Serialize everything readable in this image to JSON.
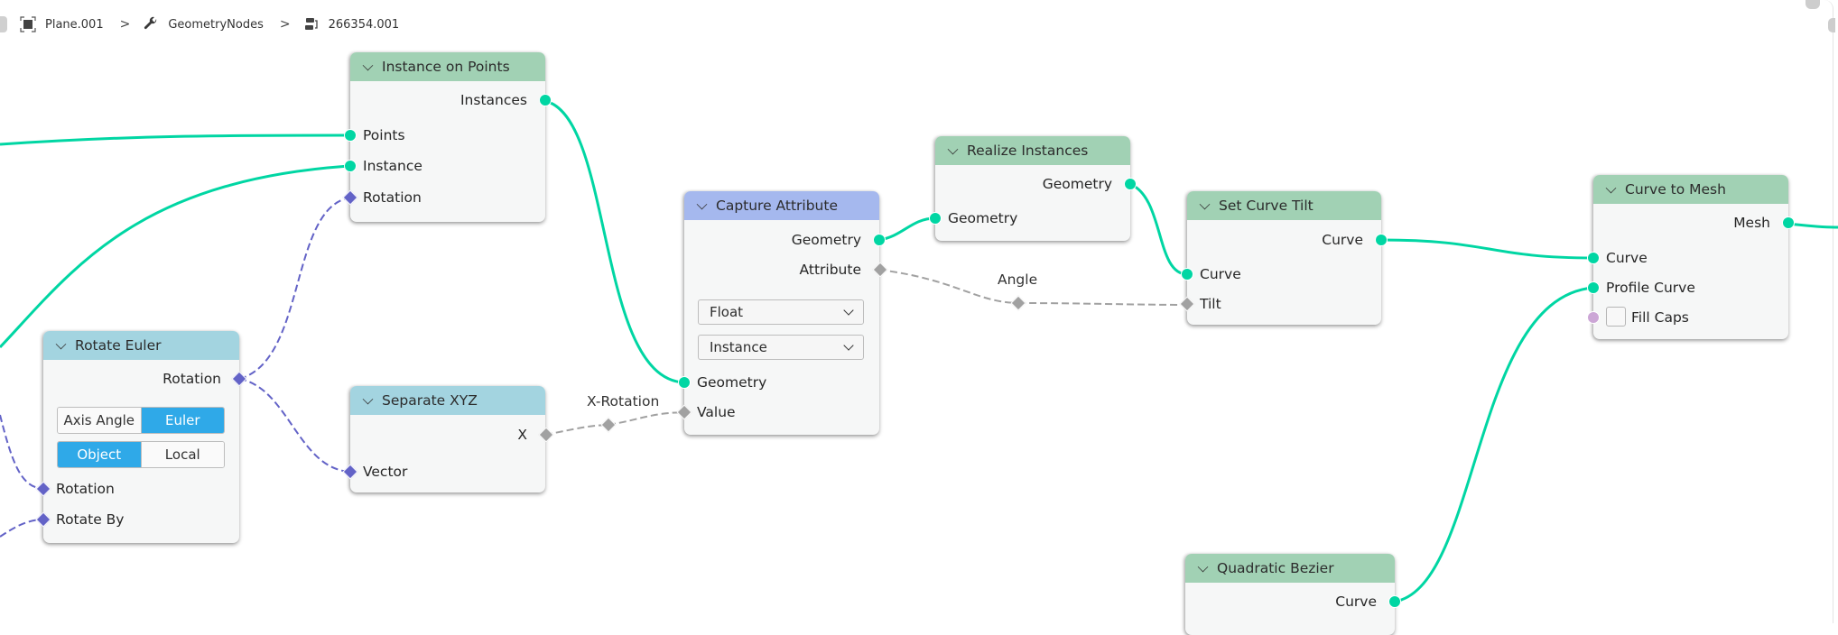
{
  "breadcrumb": {
    "items": [
      {
        "label": "Plane.001",
        "icon": "object-icon"
      },
      {
        "label": "GeometryNodes",
        "icon": "wrench-icon"
      },
      {
        "label": "266354.001",
        "icon": "node-tree-icon"
      }
    ],
    "separator": ">"
  },
  "colors": {
    "geometry_socket": "#00d6a3",
    "vector_socket": "#6363c7",
    "float_socket": "#a1a1a1",
    "boolean_socket": "#cca6d6",
    "geometry_header": "#a1d1b4",
    "vector_header": "#a3d4e0",
    "attribute_header": "#a5b8ee",
    "active_button": "#2fa9e8"
  },
  "nodes": {
    "instance_on_points": {
      "title": "Instance on Points",
      "outputs": [
        "Instances"
      ],
      "inputs": [
        "Points",
        "Instance",
        "Rotation"
      ]
    },
    "rotate_euler": {
      "title": "Rotate Euler",
      "outputs": [
        "Rotation"
      ],
      "type_options": [
        "Axis Angle",
        "Euler"
      ],
      "type_selected": "Euler",
      "space_options": [
        "Object",
        "Local"
      ],
      "space_selected": "Object",
      "inputs": [
        "Rotation",
        "Rotate By"
      ]
    },
    "separate_xyz": {
      "title": "Separate XYZ",
      "outputs": [
        "X"
      ],
      "inputs": [
        "Vector"
      ]
    },
    "capture_attribute": {
      "title": "Capture Attribute",
      "outputs": [
        "Geometry",
        "Attribute"
      ],
      "data_type": "Float",
      "domain": "Instance",
      "inputs": [
        "Geometry",
        "Value"
      ]
    },
    "realize_instances": {
      "title": "Realize Instances",
      "outputs": [
        "Geometry"
      ],
      "inputs": [
        "Geometry"
      ]
    },
    "set_curve_tilt": {
      "title": "Set Curve Tilt",
      "outputs": [
        "Curve"
      ],
      "inputs": [
        "Curve",
        "Tilt"
      ]
    },
    "curve_to_mesh": {
      "title": "Curve to Mesh",
      "outputs": [
        "Mesh"
      ],
      "inputs": [
        "Curve",
        "Profile Curve",
        "Fill Caps"
      ],
      "fill_caps_checked": false
    },
    "quadratic_bezier": {
      "title": "Quadratic Bezier",
      "outputs": [
        "Curve"
      ]
    }
  },
  "reroutes": {
    "x_rotation": "X-Rotation",
    "angle": "Angle"
  }
}
